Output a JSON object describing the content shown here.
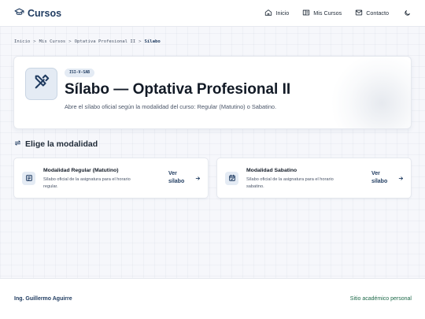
{
  "brand": {
    "name": "Cursos",
    "icon": "graduation-cap-icon"
  },
  "nav": {
    "links": [
      {
        "label": "Inicio",
        "icon": "home-icon"
      },
      {
        "label": "Mis Cursos",
        "icon": "book-open-icon"
      },
      {
        "label": "Contacto",
        "icon": "mail-icon"
      }
    ],
    "theme_icon": "moon-icon"
  },
  "breadcrumb": {
    "items": [
      "Inicio",
      "Mis Cursos",
      "Optativa Profesional II"
    ],
    "current": "Sílabo",
    "separator": ">"
  },
  "hero": {
    "icon": "tools-icon",
    "badge": "ISI-V-SAB",
    "title": "Sílabo — Optativa Profesional II",
    "subtitle": "Abre el sílabo oficial según la modalidad del curso: Regular (Matutino) o Sabatino."
  },
  "section": {
    "title": "Elige la modalidad",
    "icon": "swap-arrows-icon"
  },
  "cards": [
    {
      "title": "Modalidad Regular (Matutino)",
      "description": "Sílabo oficial de la asignatura para el horario regular.",
      "link_label": "Ver sílabo",
      "icon": "document-icon"
    },
    {
      "title": "Modalidad Sabatino",
      "description": "Sílabo oficial de la asignatura para el horario sabatino.",
      "link_label": "Ver sílabo",
      "icon": "calendar-check-icon"
    }
  ],
  "footer": {
    "author": "Ing. Guillermo Aguirre",
    "site": "Sitio académico personal"
  },
  "colors": {
    "primary": "#1e3a5f",
    "accent_green": "#1f6a4a",
    "icon_bg": "#e4ebf4"
  }
}
